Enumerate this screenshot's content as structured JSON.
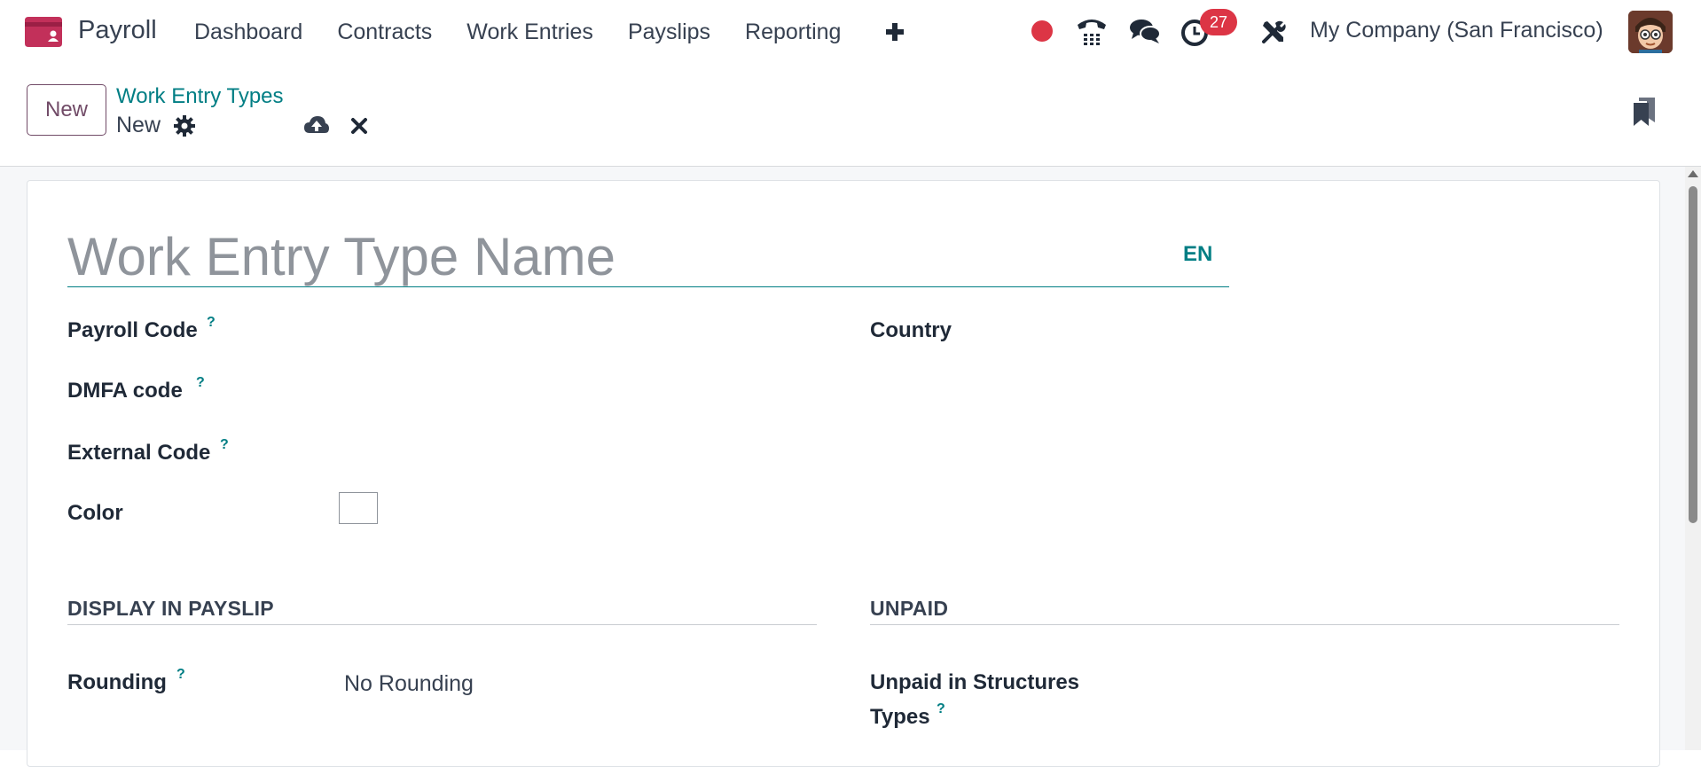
{
  "app": {
    "name": "Payroll",
    "logo_color": "#c2305a"
  },
  "menu": {
    "items": [
      {
        "label": "Dashboard"
      },
      {
        "label": "Contracts"
      },
      {
        "label": "Work Entries"
      },
      {
        "label": "Payslips"
      },
      {
        "label": "Reporting"
      }
    ]
  },
  "systray": {
    "activity_count": "27",
    "company": "My Company (San Francisco)"
  },
  "control_panel": {
    "new_button": "New",
    "breadcrumb_parent": "Work Entry Types",
    "breadcrumb_current": "New"
  },
  "form": {
    "name_placeholder": "Work Entry Type Name",
    "language": "EN",
    "fields": {
      "payroll_code": "Payroll Code",
      "dmfa_code": "DMFA code",
      "external_code": "External Code",
      "color": "Color",
      "country": "Country"
    },
    "help_mark": "?",
    "sections": {
      "display_in_payslip": "DISPLAY IN PAYSLIP",
      "unpaid": "UNPAID"
    },
    "rounding": {
      "label": "Rounding",
      "value": "No Rounding"
    },
    "unpaid_structures": {
      "label_line1": "Unpaid in Structures",
      "label_line2": "Types"
    }
  },
  "colors": {
    "brand": "#714b67",
    "link": "#017e84",
    "danger": "#dc3545"
  }
}
